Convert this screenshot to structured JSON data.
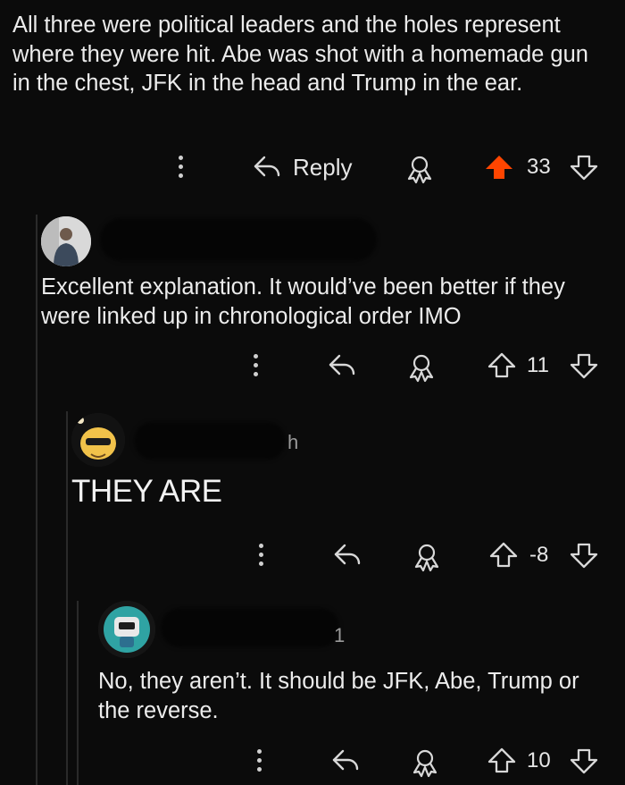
{
  "comments": [
    {
      "body": "All three were political leaders and the holes represent where they were hit. Abe was shot with a homemade gun in the chest, JFK in the head and Trump in the ear.",
      "reply_label": "Reply",
      "score": "33",
      "upvoted": true
    },
    {
      "body": "Excellent explanation. It would’ve been better if they were linked up in chronological order IMO",
      "score": "11",
      "upvoted": false
    },
    {
      "body": "THEY ARE",
      "meta_fragment": "h",
      "score": "-8",
      "upvoted": false
    },
    {
      "body": "No, they aren’t. It should be JFK, Abe, Trump or the reverse.",
      "meta_fragment": "1",
      "score": "10",
      "upvoted": false
    }
  ],
  "colors": {
    "background": "#0b0b0b",
    "upvote_active": "#ff4500",
    "text": "#ececec"
  },
  "icons": [
    "more-icon",
    "reply-icon",
    "award-icon",
    "upvote-icon",
    "downvote-icon"
  ]
}
